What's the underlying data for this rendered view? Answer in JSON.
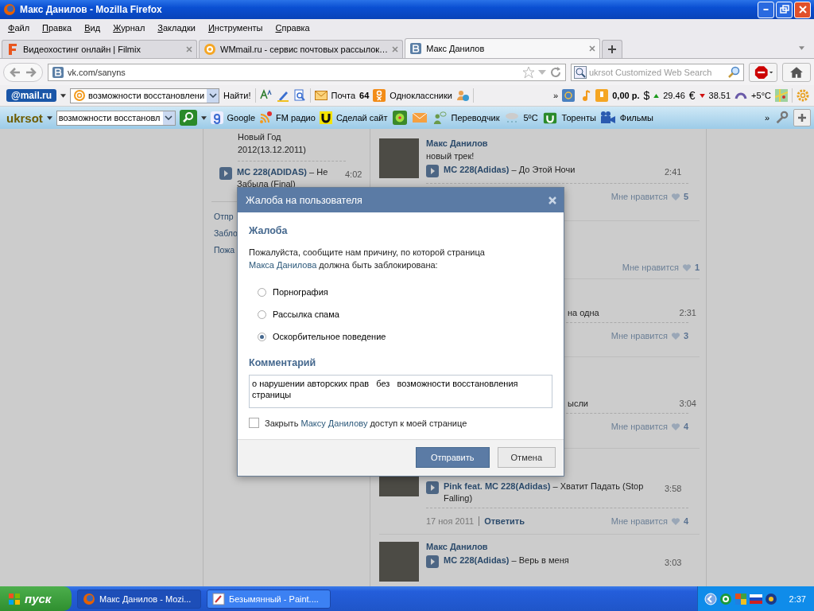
{
  "window": {
    "title": "Макс Данилов - Mozilla Firefox"
  },
  "menu": [
    "Файл",
    "Правка",
    "Вид",
    "Журнал",
    "Закладки",
    "Инструменты",
    "Справка"
  ],
  "tabs": [
    {
      "label": "Видеохостинг онлайн | Filmix",
      "selected": false
    },
    {
      "label": "WMmail.ru - сервис почтовых рассылок…",
      "selected": false
    },
    {
      "label": "Макс Данилов",
      "selected": true
    }
  ],
  "address": {
    "url": "vk.com/sanyns"
  },
  "web_search": {
    "placeholder": "ukrsot Customized Web Search"
  },
  "mail_toolbar": {
    "logo": "@mail.ru",
    "search_value": "возможности восстановлени",
    "find_button": "Найти!",
    "mail_label": "Почта",
    "mail_count": "64",
    "ok_label": "Одноклассники",
    "more": "»",
    "balance": "0,00 р.",
    "usd_sign": "$",
    "usd": "29.46",
    "eur_sign": "€",
    "eur": "38.51",
    "weather": "+5°C"
  },
  "ukrsot_toolbar": {
    "logo": "ukrsot",
    "search_value": "возможности восстановл",
    "google": "Google",
    "fm_radio": "FM радио",
    "make_site": "Сделай сайт",
    "translator": "Переводчик",
    "weather": "5ºC",
    "torrents": "Торенты",
    "films": "Фильмы",
    "more": "»"
  },
  "left_column": {
    "track_tail": "Новый Год 2012(13.12.2011)",
    "track": {
      "artist": "MC 228(ADIDAS)",
      "title": "– Не Забыла (Final)",
      "duration": "4:02"
    },
    "actions": [
      "Отпр",
      "Забло",
      "Пожа"
    ]
  },
  "feed": [
    {
      "kind": "full",
      "author": "Макс Данилов",
      "text": "новый трек!",
      "track": {
        "artist": "MC 228(Adidas)",
        "title": "– До Этой Ночи",
        "duration": "2:41"
      },
      "like_label": "Мне нравится",
      "likes": "5"
    },
    {
      "kind": "covered",
      "like_label": "Мне нравится",
      "likes": "1"
    },
    {
      "kind": "covered",
      "fragment": "на одна",
      "duration": "2:31",
      "like_label": "Мне нравится",
      "likes": "3"
    },
    {
      "kind": "covered",
      "fragment": "ысли",
      "duration": "3:04",
      "like_label": "Мне нравится",
      "likes": "4"
    },
    {
      "kind": "lower",
      "track": {
        "artist": "Pink feat. MC 228(Adidas)",
        "title": "– Хватит Падать (Stop Falling)",
        "duration": "3:58"
      },
      "date": "17 ноя 2011",
      "reply": "Ответить",
      "like_label": "Мне нравится",
      "likes": "4"
    },
    {
      "kind": "full",
      "author": "Макс Данилов",
      "track": {
        "artist": "MC 228(Adidas)",
        "title": "– Верь в меня",
        "duration": "3:03"
      }
    }
  ],
  "dialog": {
    "title": "Жалоба на пользователя",
    "heading": "Жалоба",
    "prompt_before": "Пожалуйста, сообщите нам причину, по которой страница",
    "prompt_link": "Макса Данилова",
    "prompt_after": "должна быть заблокирована:",
    "reasons": [
      {
        "label": "Порнография",
        "selected": false
      },
      {
        "label": "Рассылка спама",
        "selected": false
      },
      {
        "label": "Оскорбительное поведение",
        "selected": true
      }
    ],
    "comment_heading": "Комментарий",
    "comment": "о нарушении авторских прав   без   возможности восстановления страницы",
    "block": {
      "before": "Закрыть",
      "link": "Максу Данилову",
      "after": "доступ к моей странице",
      "checked": false
    },
    "submit": "Отправить",
    "cancel": "Отмена"
  },
  "taskbar": {
    "start": "пуск",
    "tasks": [
      {
        "label": "Макс Данилов - Mozi...",
        "selected": true
      },
      {
        "label": "Безымянный - Paint....",
        "selected": false
      }
    ],
    "clock": "2:37"
  }
}
